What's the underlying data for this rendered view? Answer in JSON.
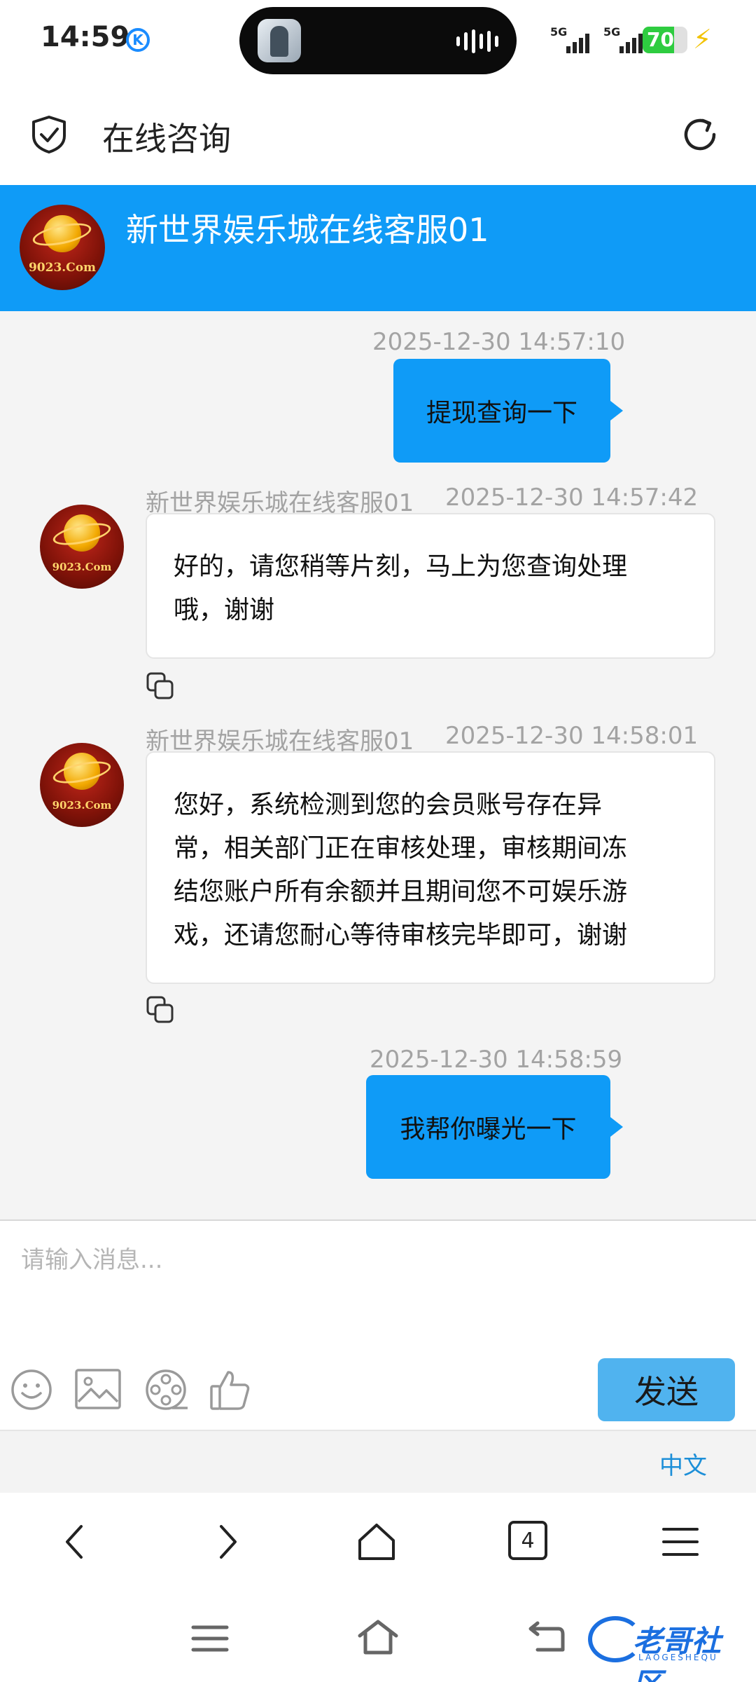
{
  "status_bar": {
    "time": "14:59",
    "badge": "K",
    "sim1": "5G",
    "sim2": "5G",
    "battery": "70",
    "battery_level": 0.7
  },
  "app_header": {
    "title": "在线咨询",
    "icons": [
      "shield-check-icon",
      "refresh-icon"
    ]
  },
  "chat_header": {
    "agent_name": "新世界娱乐城在线客服01",
    "logo_text": "9023.Com"
  },
  "messages": [
    {
      "direction": "out",
      "timestamp": "2025-12-30 14:57:10",
      "text": "提现查询一下"
    },
    {
      "direction": "in",
      "sender": "新世界娱乐城在线客服01",
      "timestamp": "2025-12-30 14:57:42",
      "lines": [
        "好的，请您稍等片刻，马上为您查询处理",
        "哦，谢谢"
      ]
    },
    {
      "direction": "in",
      "sender": "新世界娱乐城在线客服01",
      "timestamp": "2025-12-30 14:58:01",
      "lines": [
        "您好，系统检测到您的会员账号存在异",
        "常，相关部门正在审核处理，审核期间冻",
        "结您账户所有余额并且期间您不可娱乐游",
        "戏，还请您耐心等待审核完毕即可，谢谢"
      ]
    },
    {
      "direction": "out",
      "timestamp": "2025-12-30 14:58:59",
      "text": "我帮你曝光一下"
    }
  ],
  "input": {
    "placeholder": "请输入消息...",
    "tools": [
      "emoji-icon",
      "image-icon",
      "video-reel-icon",
      "thumbs-up-icon"
    ],
    "send_label": "发送"
  },
  "language": "中文",
  "browser_nav": {
    "tab_count": "4",
    "icons": [
      "back-icon",
      "forward-icon",
      "home-icon",
      "tabs-icon",
      "menu-icon"
    ]
  },
  "watermark": {
    "text": "老哥社区",
    "sub": "LAOGESHEQU"
  },
  "colors": {
    "accent": "#0f9bf7",
    "send_button": "#50b3ef",
    "language_link": "#1d8fd8",
    "background": "#f4f4f4"
  }
}
